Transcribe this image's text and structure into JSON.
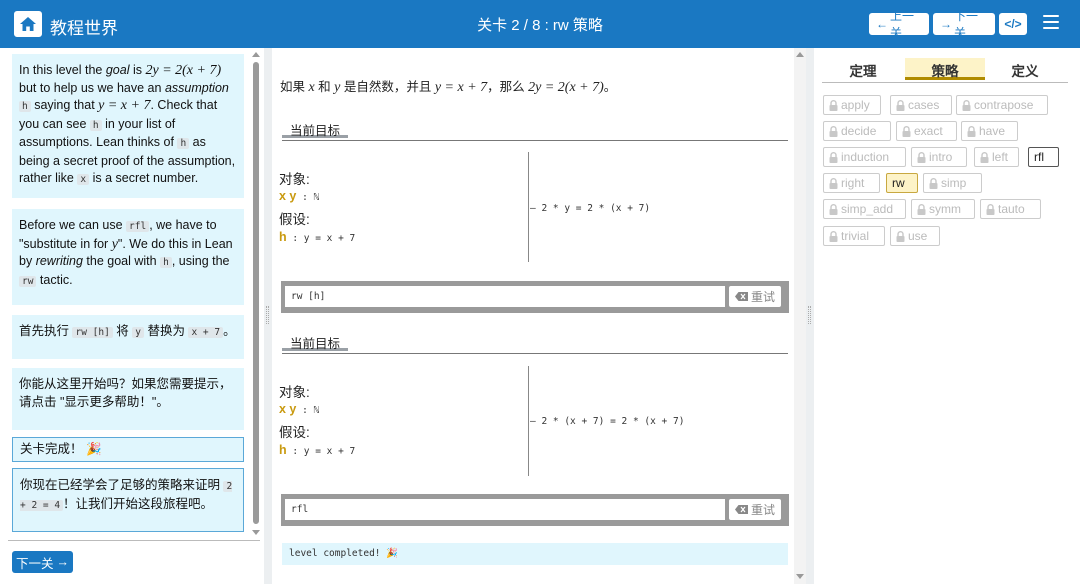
{
  "header": {
    "brand": "教程世界",
    "level_title": "关卡 2 / 8 : rw 策略",
    "prev_label": "上一关",
    "next_label": "下一关",
    "code_label": "</>"
  },
  "left": {
    "msg1": {
      "t1": "In this level the ",
      "goal": "goal",
      "t2": " is ",
      "m1": "2y = 2(x + 7)",
      "t3": " but to help us we have an ",
      "assumption": "assumption",
      "c1": "h",
      "t4": " saying that ",
      "m2": "y = x + 7",
      "t5": ". Check that you can see ",
      "c2": "h",
      "t6": " in your list of assumptions. Lean thinks of ",
      "c3": "h",
      "t7": " as being a secret proof of the assumption, rather like ",
      "c4": "x",
      "t8": " is a secret number."
    },
    "msg2": {
      "t1": "Before we can use ",
      "c1": "rfl",
      "t2": ", we have to \"substitute in for ",
      "m1": "y",
      "t3": "\". We do this in Lean by ",
      "rewriting": "rewriting",
      "t4": " the goal with ",
      "c2": "h",
      "t5": ", using the ",
      "c3": "rw",
      "t6": " tactic."
    },
    "msg3": {
      "t1": "首先执行 ",
      "c1": "rw [h]",
      "t2": " 将 ",
      "c2": "y",
      "t3": " 替换为 ",
      "c3": "x + 7",
      "t4": "。"
    },
    "msg4": "你能从这里开始吗？如果您需要提示，请点击 \"显示更多帮助！\"。",
    "msg5": "关卡完成！ 🎉",
    "msg6": {
      "t1": "你现在已经学会了足够的策略来证明 ",
      "c1": "2 + 2 = 4",
      "t2": "！让我们开始这段旅程吧。"
    },
    "next_button": "下一关"
  },
  "middle": {
    "intro": {
      "t1": "如果 ",
      "m1": "x",
      "t2": " 和 ",
      "m2": "y",
      "t3": " 是自然数，并且 ",
      "m3": "y = x + 7",
      "t4": "，那么 ",
      "m4": "2y = 2(x + 7)",
      "t5": "。"
    },
    "goal_tab": "当前目标",
    "objects_label": "对象:",
    "objects_names": "x y",
    "objects_type": " : ℕ",
    "assumptions_label": "假设:",
    "hyp_name": "h",
    "hyp_value": " : y = x + 7",
    "goal1": "2 * y = 2 * (x + 7)",
    "goal2": "2 * (x + 7) = 2 * (x + 7)",
    "cmd1": "rw [h]",
    "cmd2": "rfl",
    "retry_label": "重试",
    "done": "level completed! 🎉"
  },
  "right": {
    "tabs": [
      "定理",
      "策略",
      "定义"
    ],
    "tactics": [
      "apply",
      "cases",
      "contrapose",
      "decide",
      "exact",
      "have",
      "induction",
      "intro",
      "left",
      "rfl",
      "right",
      "rw",
      "simp",
      "simp_add",
      "symm",
      "tauto",
      "trivial",
      "use"
    ]
  }
}
